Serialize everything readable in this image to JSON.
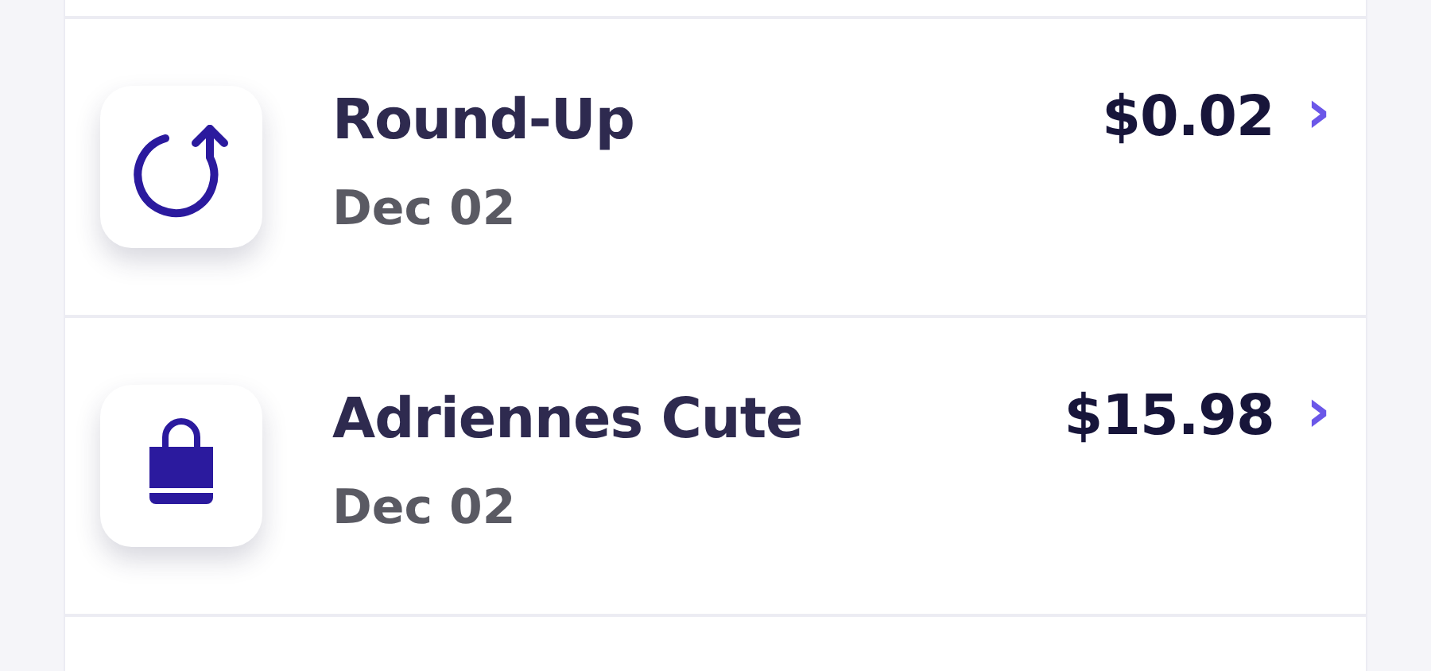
{
  "transactions": [
    {
      "kind": "round-up",
      "title": "Round-Up",
      "date": "Dec 02",
      "amount": "$0.02",
      "chevron": "›"
    },
    {
      "kind": "shopping",
      "title": "Adriennes Cute",
      "date": "Dec 02",
      "amount": "$15.98",
      "chevron": "›"
    }
  ]
}
